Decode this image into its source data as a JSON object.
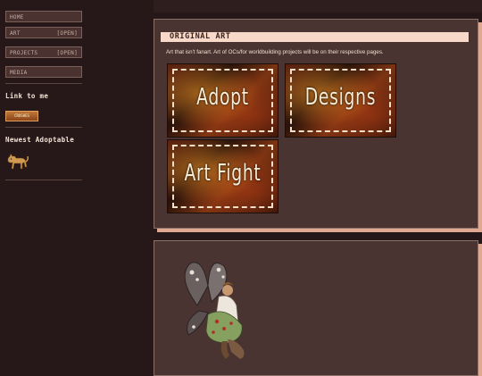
{
  "sidebar": {
    "nav": [
      {
        "label": "HOME",
        "tag": ""
      },
      {
        "label": "ART",
        "tag": "[OPEN]"
      },
      {
        "label": "PROJECTS",
        "tag": "[OPEN]"
      },
      {
        "label": "MEDIA",
        "tag": ""
      }
    ],
    "link_heading": "Link to me",
    "link_button_text": "CRUSHES",
    "adoptable_heading": "Newest Adoptable"
  },
  "main": {
    "title": "ORIGINAL ART",
    "description": "Art that isn't fanart. Art of OCs/for worldbuilding projects will be on their respective pages.",
    "tiles": [
      {
        "label": "Adopt"
      },
      {
        "label": "Designs"
      },
      {
        "label": "Art Fight"
      }
    ]
  }
}
